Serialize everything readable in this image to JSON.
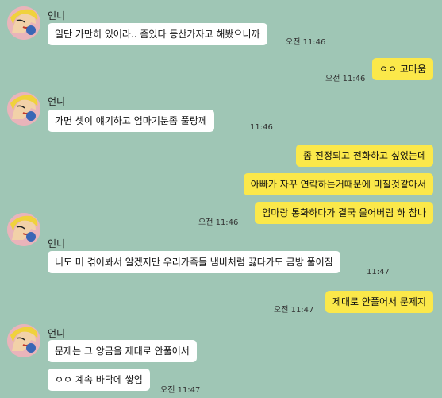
{
  "chat": {
    "sender_name": "언니",
    "messages": [
      {
        "side": "in",
        "text": "일단 가만히 있어라.. 좀있다 등산가자고 해봤으니까",
        "time": "오전 11:46"
      },
      {
        "side": "out",
        "text": "ㅇㅇ 고마움",
        "time": "오전 11:46"
      },
      {
        "side": "in",
        "text": "가면 셋이 얘기하고 엄마기분좀 풀랑께",
        "time": "11:46"
      },
      {
        "side": "out",
        "text": "좀 진정되고 전화하고 싶었는데",
        "time": ""
      },
      {
        "side": "out",
        "text": "아빠가 자꾸 연락하는거때문에 미칠것같아서",
        "time": ""
      },
      {
        "side": "out",
        "text": "엄마랑 통화하다가 결국 울어버림 하 참나",
        "time": "오전 11:46"
      },
      {
        "side": "in",
        "text": "니도 머 겪어봐서 알겠지만 우리가족들 냄비처럼 끓다가도 금방 풀어짐",
        "time": "11:47"
      },
      {
        "side": "out",
        "text": "제대로 안풀어서 문제지",
        "time": "오전 11:47"
      },
      {
        "side": "in",
        "text": "문제는 그 앙금을 제대로 안풀어서",
        "time": ""
      },
      {
        "side": "in",
        "text": "ㅇㅇ 계속 바닥에 쌓임",
        "time": "오전 11:47"
      }
    ]
  },
  "colors": {
    "background": "#9fc6b5",
    "incoming_bubble": "#ffffff",
    "outgoing_bubble": "#fbe84a"
  }
}
